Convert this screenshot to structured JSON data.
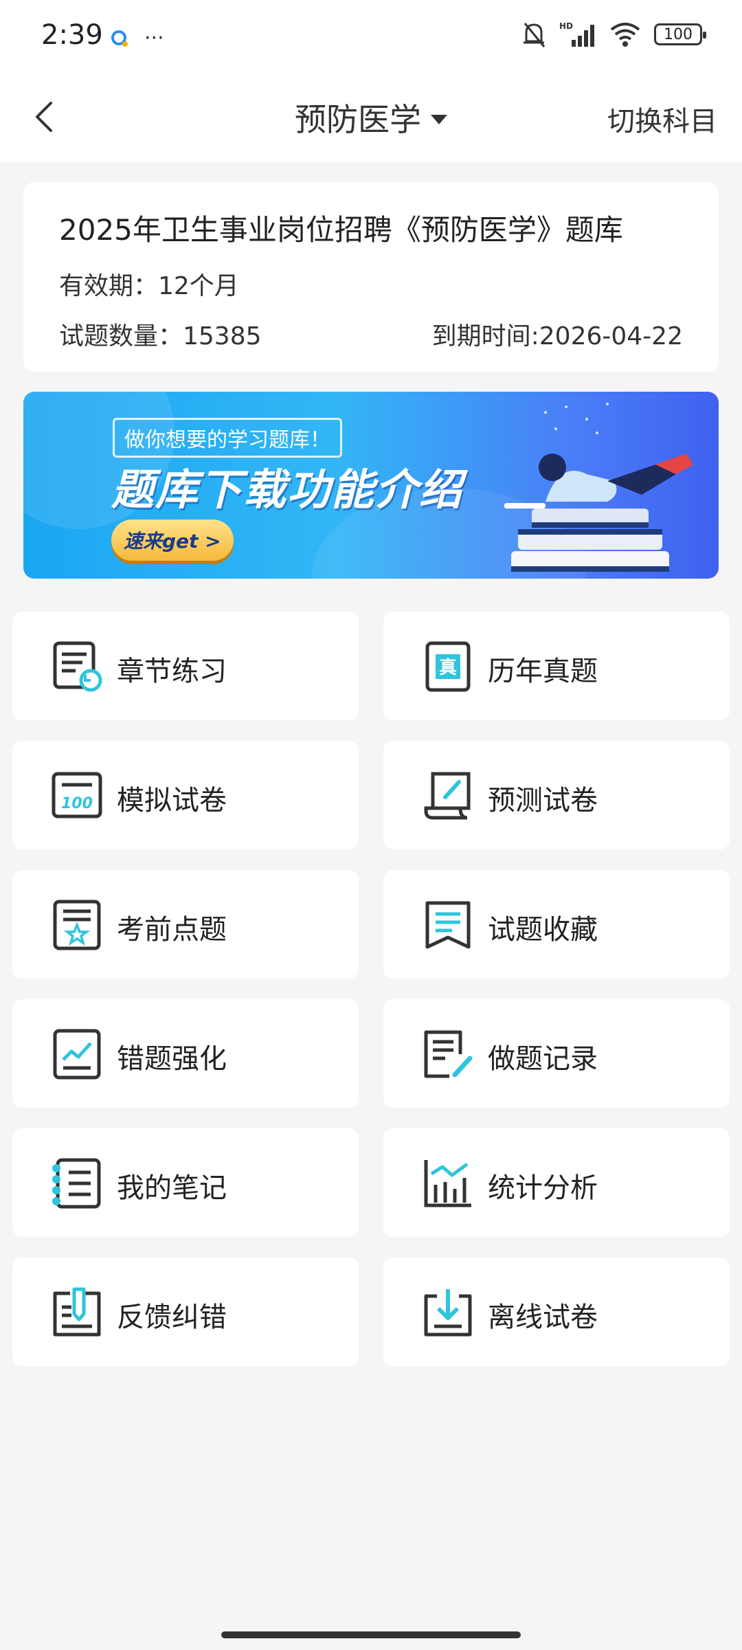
{
  "status": {
    "time": "2:39",
    "battery": "100"
  },
  "nav": {
    "title": "预防医学",
    "switch_label": "切换科目"
  },
  "info": {
    "title": "2025年卫生事业岗位招聘《预防医学》题库",
    "valid": "有效期：12个月",
    "count": "试题数量：15385",
    "expire": "到期时间:2026-04-22"
  },
  "banner": {
    "subtitle": "做你想要的学习题库！",
    "title": "题库下载功能介绍",
    "button": "速来get >"
  },
  "tiles": [
    {
      "label": "章节练习",
      "icon": "chapter-practice-icon"
    },
    {
      "label": "历年真题",
      "icon": "past-exam-icon"
    },
    {
      "label": "模拟试卷",
      "icon": "mock-paper-icon"
    },
    {
      "label": "预测试卷",
      "icon": "predict-paper-icon"
    },
    {
      "label": "考前点题",
      "icon": "key-points-icon"
    },
    {
      "label": "试题收藏",
      "icon": "favorites-icon"
    },
    {
      "label": "错题强化",
      "icon": "wrong-questions-icon"
    },
    {
      "label": "做题记录",
      "icon": "history-record-icon"
    },
    {
      "label": "我的笔记",
      "icon": "notes-icon"
    },
    {
      "label": "统计分析",
      "icon": "statistics-icon"
    },
    {
      "label": "反馈纠错",
      "icon": "feedback-icon"
    },
    {
      "label": "离线试卷",
      "icon": "offline-download-icon"
    }
  ],
  "colors": {
    "accent": "#2ec5dc",
    "banner_start": "#1aa7f2",
    "banner_end": "#3f61f0"
  }
}
